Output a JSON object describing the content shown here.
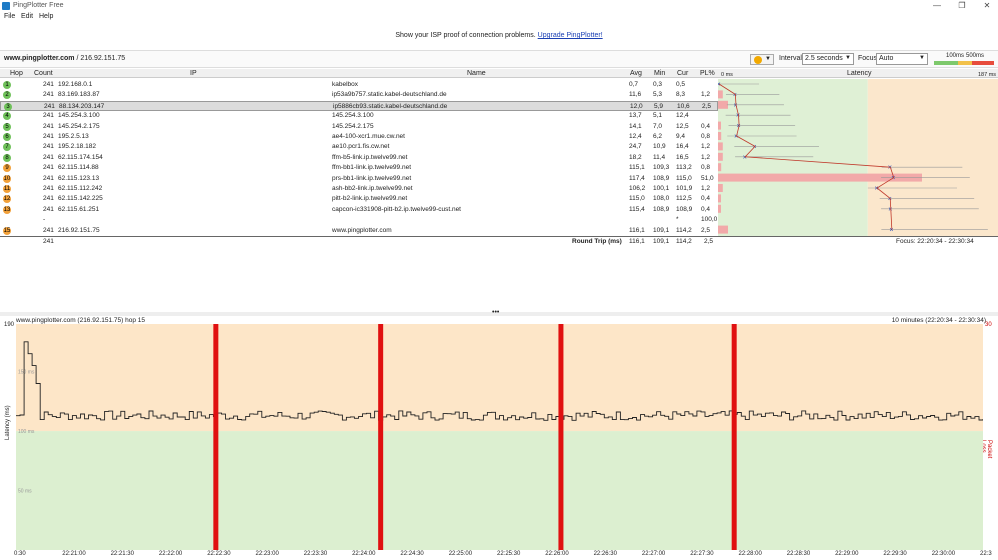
{
  "window": {
    "title": "PingPlotter Free",
    "minimize": "—",
    "maximize": "❐",
    "close": "✕"
  },
  "menu": [
    "File",
    "Edit",
    "Help"
  ],
  "promo": {
    "text": "Show your ISP proof of connection problems.",
    "link": "Upgrade PingPlotter!"
  },
  "toolbar": {
    "target_host": "www.pingplotter.com",
    "target_ip": " / 216.92.151.75",
    "interval_label": "Interval",
    "interval_value": "2.5 seconds",
    "focus_label": "Focus",
    "focus_value": "Auto",
    "legend": [
      "100ms",
      "500ms"
    ]
  },
  "columns": {
    "hop": "Hop",
    "count": "Count",
    "ip": "IP",
    "name": "Name",
    "avg": "Avg",
    "min": "Min",
    "cur": "Cur",
    "pl": "PL%",
    "latency": "Latency",
    "scale_left": "0 ms",
    "scale_right": "187 ms"
  },
  "hops": [
    {
      "hop": "1",
      "count": "241",
      "ip": "192.168.0.1",
      "name": "kabelbox",
      "avg": "0,7",
      "min": "0,3",
      "cur": "0,5",
      "pl": "",
      "color": "#6fc15a",
      "lat": 0.7,
      "loss": 0
    },
    {
      "hop": "2",
      "count": "241",
      "ip": "83.169.183.87",
      "name": "ip53a9b757.static.kabel-deutschland.de",
      "avg": "11,6",
      "min": "5,3",
      "cur": "8,3",
      "pl": "1,2",
      "color": "#6fc15a",
      "lat": 11.6,
      "loss": 1.2
    },
    {
      "hop": "3",
      "count": "241",
      "ip": "88.134.203.147",
      "name": "ip5886cb93.static.kabel-deutschland.de",
      "avg": "12,0",
      "min": "5,9",
      "cur": "10,6",
      "pl": "2,5",
      "color": "#6fc15a",
      "lat": 12.0,
      "loss": 2.5
    },
    {
      "hop": "4",
      "count": "241",
      "ip": "145.254.3.100",
      "name": "145.254.3.100",
      "avg": "13,7",
      "min": "5,1",
      "cur": "12,4",
      "pl": "",
      "color": "#6fc15a",
      "lat": 13.7,
      "loss": 0
    },
    {
      "hop": "5",
      "count": "241",
      "ip": "145.254.2.175",
      "name": "145.254.2.175",
      "avg": "14,1",
      "min": "7,0",
      "cur": "12,5",
      "pl": "0,4",
      "color": "#6fc15a",
      "lat": 14.1,
      "loss": 0.4
    },
    {
      "hop": "6",
      "count": "241",
      "ip": "195.2.5.13",
      "name": "ae4-100-xcr1.mue.cw.net",
      "avg": "12,4",
      "min": "6,2",
      "cur": "9,4",
      "pl": "0,8",
      "color": "#6fc15a",
      "lat": 12.4,
      "loss": 0.8
    },
    {
      "hop": "7",
      "count": "241",
      "ip": "195.2.18.182",
      "name": "ae10.pcr1.fis.cw.net",
      "avg": "24,7",
      "min": "10,9",
      "cur": "16,4",
      "pl": "1,2",
      "color": "#6fc15a",
      "lat": 24.7,
      "loss": 1.2
    },
    {
      "hop": "8",
      "count": "241",
      "ip": "62.115.174.154",
      "name": "ffm-b5-link.ip.twelve99.net",
      "avg": "18,2",
      "min": "11,4",
      "cur": "16,5",
      "pl": "1,2",
      "color": "#6fc15a",
      "lat": 18.2,
      "loss": 1.2
    },
    {
      "hop": "9",
      "count": "241",
      "ip": "62.115.114.88",
      "name": "ffm-bb1-link.ip.twelve99.net",
      "avg": "115,1",
      "min": "109,3",
      "cur": "113,2",
      "pl": "0,8",
      "color": "#f2a13a",
      "lat": 115.1,
      "loss": 0.8
    },
    {
      "hop": "10",
      "count": "241",
      "ip": "62.115.123.13",
      "name": "prs-bb1-link.ip.twelve99.net",
      "avg": "117,4",
      "min": "108,9",
      "cur": "115,0",
      "pl": "51,0",
      "color": "#f2a13a",
      "lat": 117.4,
      "loss": 51.0
    },
    {
      "hop": "11",
      "count": "241",
      "ip": "62.115.112.242",
      "name": "ash-bb2-link.ip.twelve99.net",
      "avg": "106,2",
      "min": "100,1",
      "cur": "101,9",
      "pl": "1,2",
      "color": "#f2a13a",
      "lat": 106.2,
      "loss": 1.2
    },
    {
      "hop": "12",
      "count": "241",
      "ip": "62.115.142.225",
      "name": "pitt-b2-link.ip.twelve99.net",
      "avg": "115,0",
      "min": "108,0",
      "cur": "112,5",
      "pl": "0,4",
      "color": "#f2a13a",
      "lat": 115.0,
      "loss": 0.4
    },
    {
      "hop": "13",
      "count": "241",
      "ip": "62.115.61.251",
      "name": "capcon-ic331908-pitt-b2.ip.twelve99-cust.net",
      "avg": "115,4",
      "min": "108,9",
      "cur": "108,9",
      "pl": "0,4",
      "color": "#f2a13a",
      "lat": 115.4,
      "loss": 0.4
    },
    {
      "hop": "",
      "count": "-",
      "ip": "",
      "name": "",
      "avg": "",
      "min": "",
      "cur": "*",
      "pl": "100,0",
      "color": "",
      "lat": null,
      "loss": 0
    },
    {
      "hop": "15",
      "count": "241",
      "ip": "216.92.151.75",
      "name": "www.pingplotter.com",
      "avg": "116,1",
      "min": "109,1",
      "cur": "114,2",
      "pl": "2,5",
      "color": "#f2a13a",
      "lat": 116.1,
      "loss": 2.5
    }
  ],
  "roundtrip": {
    "count": "241",
    "label": "Round Trip (ms)",
    "avg": "116,1",
    "min": "109,1",
    "cur": "114,2",
    "pl": "2,5",
    "focus": "Focus: 22:20:34 - 22:30:34"
  },
  "graph": {
    "title": "www.pingplotter.com (216.92.151.75) hop 15",
    "range": "10 minutes (22:20:34 - 22:30:34)",
    "y_top": "190",
    "y_right_top": "30",
    "y_label": "Latency (ms)",
    "y_right_label": "Packet Loss %",
    "y_marks": [
      "150 ms",
      "100 ms",
      "50 ms"
    ],
    "x_ticks": [
      "0:30",
      "22:21:00",
      "22:21:30",
      "22:22:00",
      "22:22:30",
      "22:23:00",
      "22:23:30",
      "22:24:00",
      "22:24:30",
      "22:25:00",
      "22:25:30",
      "22:26:00",
      "22:26:30",
      "22:27:00",
      "22:27:30",
      "22:28:00",
      "22:28:30",
      "22:29:00",
      "22:29:30",
      "22:30:00",
      "22:3"
    ],
    "loss_events": [
      0.414,
      0.766,
      1.151,
      1.521
    ]
  }
}
